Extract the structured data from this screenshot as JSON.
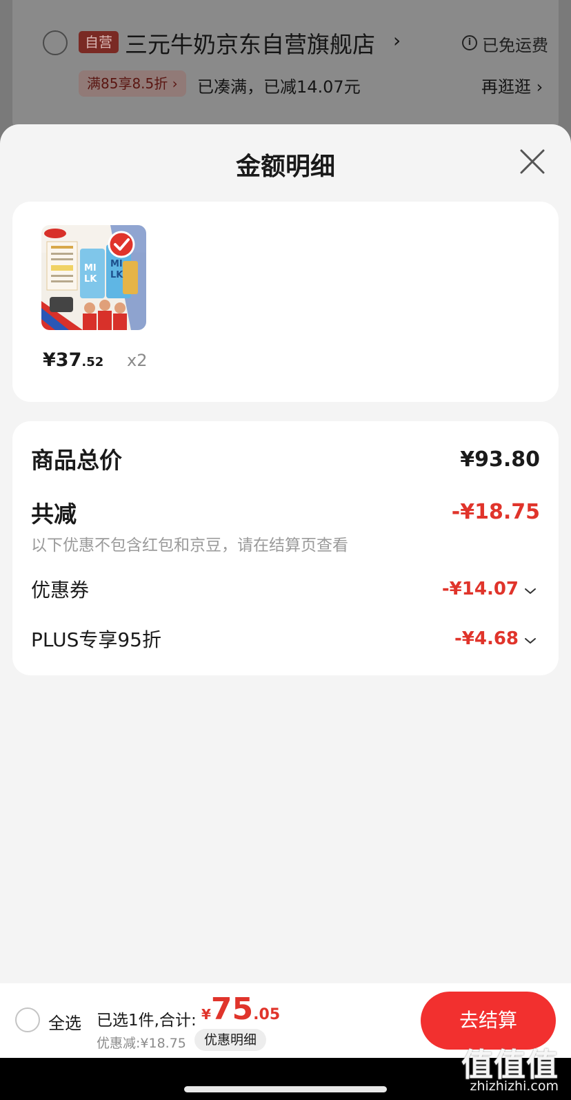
{
  "background_store": {
    "self_operated_badge": "自营",
    "store_name": "三元牛奶京东自营旗舰店",
    "free_shipping": "已免运费",
    "promo_tag": "满85享8.5折 ›",
    "promo_status": "已凑满，已减14.07元",
    "shop_more": "再逛逛 ›"
  },
  "sheet": {
    "title": "金额明细",
    "product": {
      "price_int": "¥37",
      "price_dec": ".52",
      "quantity": "x2"
    },
    "summary": {
      "total_label": "商品总价",
      "total_value": "¥93.80",
      "reduce_label": "共减",
      "reduce_value": "-¥18.75",
      "note": "以下优惠不包含红包和京豆，请在结算页查看",
      "items": [
        {
          "label": "优惠券",
          "value": "-¥14.07"
        },
        {
          "label": "PLUS专享95折",
          "value": "-¥4.68"
        }
      ]
    }
  },
  "bottom_bar": {
    "select_all": "全选",
    "selected_text": "已选1件,合计:",
    "total_currency": "¥",
    "total_int": "75",
    "total_dec": ".05",
    "discount_text": "优惠减:¥18.75",
    "detail_button": "优惠明细",
    "checkout_button": "去结算"
  },
  "watermark": {
    "logo": "值值值",
    "url": "zhizhizhi.com"
  },
  "colors": {
    "accent_red": "#e0342b",
    "checkout_red": "#f2302f",
    "sheet_bg": "#f4f4f4",
    "card_bg": "#ffffff"
  },
  "icons": {
    "close": "close-icon",
    "info": "info-icon",
    "chevron": "chevron-down-icon",
    "check": "check-badge-icon"
  }
}
